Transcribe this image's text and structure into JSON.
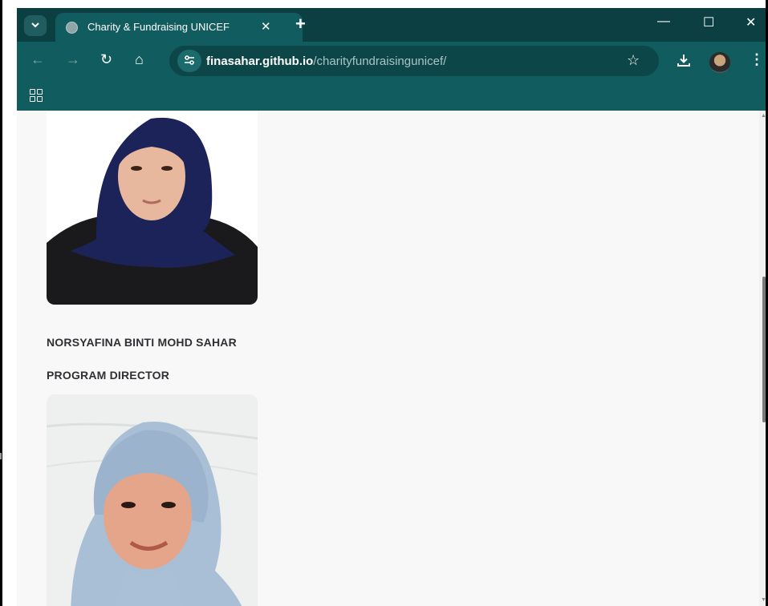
{
  "browser": {
    "tab": {
      "title": "Charity & Fundraising UNICEF",
      "close_glyph": "✕"
    },
    "new_tab_glyph": "+",
    "window_controls": {
      "minimize": "—",
      "maximize": "☐",
      "close": "✕"
    },
    "nav": {
      "back": "←",
      "forward": "→",
      "reload": "↻",
      "home": "⌂"
    },
    "url": {
      "host": "finasahar.github.io",
      "path": "/charityfundraisingunicef/"
    },
    "icons": {
      "tab_search": "chevron-down-icon",
      "site_info": "tune-icon",
      "bookmark": "star-icon",
      "download": "download-icon",
      "menu": "more-vert-icon",
      "apps": "apps-grid-icon"
    },
    "theme_color": "#115c5e"
  },
  "page": {
    "members": [
      {
        "name": "NORSYAFINA BINTI MOHD SAHAR",
        "role": "PROGRAM DIRECTOR"
      }
    ]
  }
}
